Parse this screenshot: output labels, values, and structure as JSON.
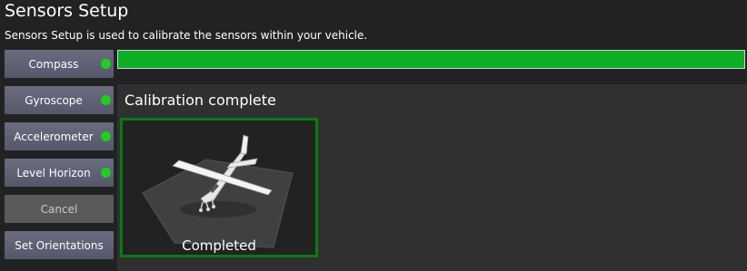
{
  "page": {
    "title": "Sensors Setup",
    "subtitle": "Sensors Setup is used to calibrate the sensors within your vehicle."
  },
  "sidebar": {
    "items": [
      {
        "label": "Compass",
        "status": "complete"
      },
      {
        "label": "Gyroscope",
        "status": "complete"
      },
      {
        "label": "Accelerometer",
        "status": "complete"
      },
      {
        "label": "Level Horizon",
        "status": "complete"
      },
      {
        "label": "Cancel",
        "status": "disabled"
      },
      {
        "label": "Set Orientations",
        "status": "none"
      }
    ]
  },
  "progress": {
    "value": 1.0
  },
  "calibration": {
    "status_text": "Calibration complete",
    "caption": "Completed",
    "icon": "airplane-icon"
  },
  "colors": {
    "background": "#222222",
    "panel": "#303030",
    "progress_fill": "#0fae27",
    "status_dot": "#22cc22",
    "box_border": "#0b7a12"
  }
}
